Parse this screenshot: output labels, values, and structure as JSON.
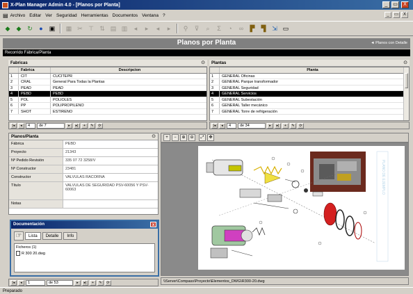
{
  "window": {
    "title": "X-Plan Manager Admin 4.0 - [Planos por Planta]",
    "minimize": "_",
    "restore": "▭",
    "close": "X"
  },
  "menu": {
    "items": [
      "Archivo",
      "Editar",
      "Ver",
      "Seguridad",
      "Herramientas",
      "Documentos",
      "Ventana",
      "?"
    ],
    "mdi_minimize": "_",
    "mdi_restore": "▭",
    "mdi_close": "X"
  },
  "header": {
    "title": "Planos por Planta",
    "link": "◄ Planos con Detalle"
  },
  "breadcrumb": "Recorrido Fábrica/Planta",
  "fabricas": {
    "panel_title": "Fabricas",
    "col_fabrica": "Fabrica",
    "col_descripcion": "Descripcion",
    "rows": [
      {
        "num": "1",
        "fabrica": "CIT",
        "descripcion": "CUCITEPR"
      },
      {
        "num": "2",
        "fabrica": "CRAL",
        "descripcion": "General Para Todas la Plantas"
      },
      {
        "num": "3",
        "fabrica": "PEAD",
        "descripcion": "PEAD"
      },
      {
        "num": "4",
        "fabrica": "PEBD",
        "descripcion": "PEBD"
      },
      {
        "num": "5",
        "fabrica": "POL",
        "descripcion": "POLIOLES"
      },
      {
        "num": "6",
        "fabrica": "PP",
        "descripcion": "POLIPROPILENO"
      },
      {
        "num": "7",
        "fabrica": "SHOT",
        "descripcion": "ESTIRENO"
      }
    ],
    "selected_index": 3,
    "nav_record": "4",
    "nav_of": "de 7"
  },
  "plantas": {
    "panel_title": "Plantas",
    "col_planta": "Planta",
    "rows": [
      {
        "num": "1",
        "planta": "GENERAL Oficinas"
      },
      {
        "num": "2",
        "planta": "GENERAL Parque transformador"
      },
      {
        "num": "3",
        "planta": "GENERAL Seguridad"
      },
      {
        "num": "4",
        "planta": "GENERAL Servicios"
      },
      {
        "num": "5",
        "planta": "GENERAL Subestación"
      },
      {
        "num": "6",
        "planta": "GENERAL Taller mecánico"
      },
      {
        "num": "7",
        "planta": "GENERAL Torre de refrigeración"
      }
    ],
    "selected_index": 3,
    "nav_record": "4",
    "nav_of": "de 34"
  },
  "plano_form": {
    "panel_title": "Planos/Planta",
    "fields": [
      {
        "label": "Fábrica",
        "value": "PEBD"
      },
      {
        "label": "Proyecto",
        "value": "21343"
      },
      {
        "label": "Nº Pedido Revisión",
        "value": "335 07 72 3258/V"
      },
      {
        "label": "Nº Constructor",
        "value": "23481"
      },
      {
        "label": "Constructor",
        "value": "VALVULAS RACORNA"
      },
      {
        "label": "Título",
        "value": "VALVULAS DE SEGURIDAD PSV-60056 Y PSV-60063"
      },
      {
        "label": "Notas",
        "value": ""
      }
    ]
  },
  "documentacion": {
    "title": "Documentación",
    "close": "x",
    "tabs": [
      "Lista",
      "Detalle",
      "Info"
    ],
    "active_tab": 0,
    "files_label": "Ficheros (1)",
    "files": [
      "R 300 20.dwg"
    ]
  },
  "plano_nav": {
    "record": "1",
    "of": "de 53"
  },
  "viewer": {
    "path": "\\\\Server\\Compass\\Proyecto\\Elementos_DWG\\R300-20.dwg",
    "stamp": "PLANO DE EJEMPLO"
  },
  "status": "Preparado"
}
